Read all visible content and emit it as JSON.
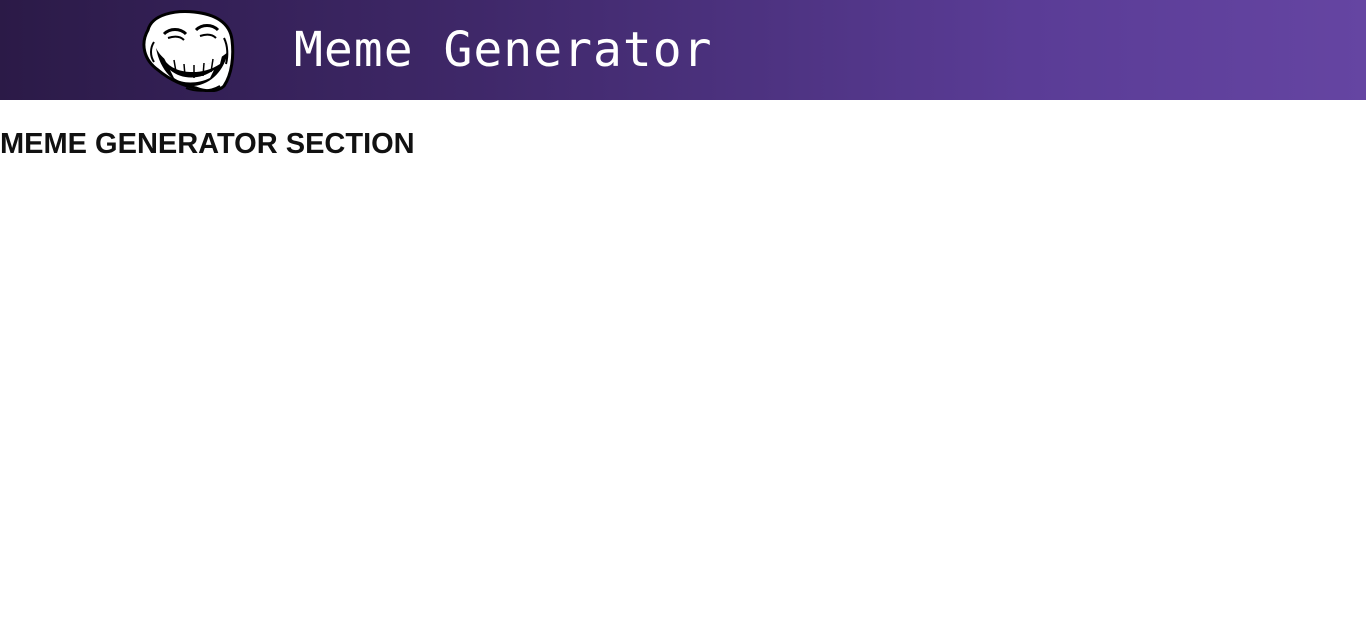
{
  "header": {
    "logo_icon": "troll-face-icon",
    "title": "Meme Generator",
    "gradient_start": "#2b1a47",
    "gradient_end": "#6545a2"
  },
  "main": {
    "section_title": "MEME GENERATOR SECTION"
  }
}
